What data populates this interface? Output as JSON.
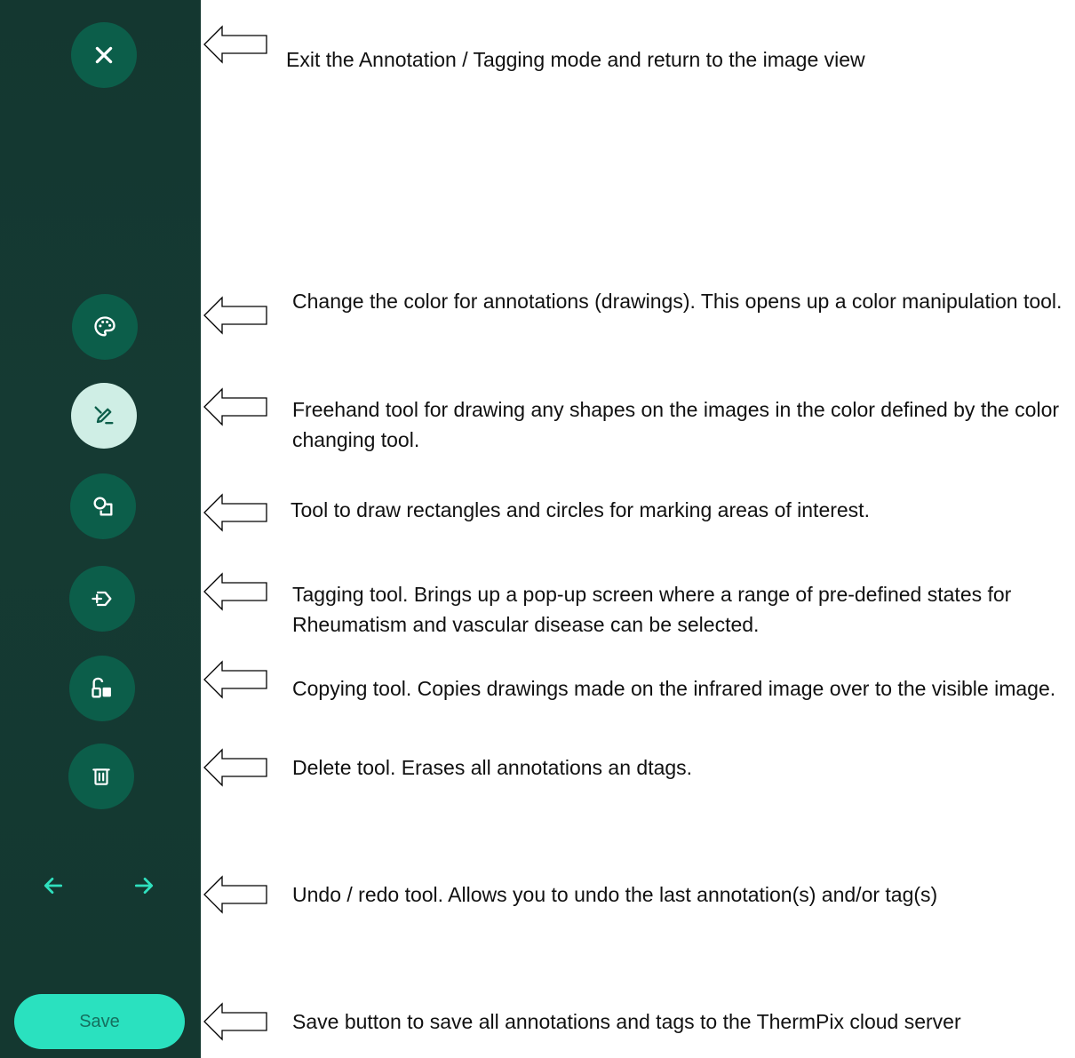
{
  "toolbar": {
    "buttons": [
      {
        "name": "exit-button",
        "icon": "close-icon"
      },
      {
        "name": "color-button",
        "icon": "palette-icon"
      },
      {
        "name": "freehand-button",
        "icon": "pencil-icon",
        "active": true
      },
      {
        "name": "shapes-button",
        "icon": "shapes-icon"
      },
      {
        "name": "tag-button",
        "icon": "tag-icon"
      },
      {
        "name": "copy-button",
        "icon": "copy-icon"
      },
      {
        "name": "delete-button",
        "icon": "trash-icon"
      }
    ],
    "undo_icon": "arrow-left-icon",
    "redo_icon": "arrow-right-icon",
    "save_label": "Save",
    "colors": {
      "panel": "#143730",
      "button": "#0c5e4a",
      "active_button": "#cfeee5",
      "icon": "#ffffff",
      "accent": "#2ae1bf"
    }
  },
  "callouts": [
    {
      "text": "Exit the Annotation / Tagging mode and return to the image view"
    },
    {
      "text": "Change the color for annotations (drawings). This opens up a color manipulation tool."
    },
    {
      "text": "Freehand tool for drawing any shapes on the images in the color defined by the color changing tool."
    },
    {
      "text": "Tool to draw rectangles and circles for marking areas of interest."
    },
    {
      "text": "Tagging tool. Brings up a pop-up screen where a range of pre-defined states for Rheumatism and vascular disease can be selected."
    },
    {
      "text": "Copying tool. Copies drawings made on the infrared image over to the visible image."
    },
    {
      "text": "Delete tool. Erases all annotations an dtags."
    },
    {
      "text": "Undo / redo tool. Allows you to undo the last annotation(s) and/or tag(s)"
    },
    {
      "text": "Save button to save all annotations and tags to the ThermPix cloud server"
    }
  ]
}
